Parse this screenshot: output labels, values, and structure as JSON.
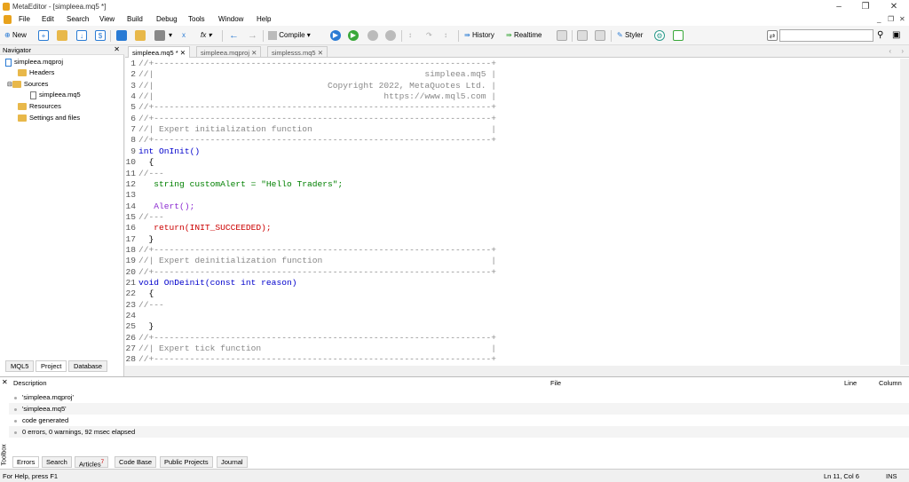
{
  "window": {
    "title": "MetaEditor - [simpleea.mq5 *]"
  },
  "menu": [
    "File",
    "Edit",
    "Search",
    "View",
    "Build",
    "Debug",
    "Tools",
    "Window",
    "Help"
  ],
  "toolbar": {
    "new": "New",
    "compile": "Compile",
    "history": "History",
    "realtime": "Realtime",
    "styler": "Styler"
  },
  "search": {
    "value": ""
  },
  "navigator": {
    "title": "Navigator",
    "project": "simpleea.mqproj",
    "headers": "Headers",
    "sources": "Sources",
    "source_file": "simpleea.mq5",
    "resources": "Resources",
    "settings": "Settings and files",
    "tabs": [
      "MQL5",
      "Project",
      "Database"
    ]
  },
  "file_tabs": [
    "simpleea.mq5 *",
    "simpleea.mqproj",
    "simplesss.mq5"
  ],
  "code_lines": [
    {
      "n": "1",
      "t": "//+------------------------------------------------------------------+"
    },
    {
      "n": "2",
      "t": "//|                                                     simpleea.mq5 |"
    },
    {
      "n": "3",
      "t": "//|                                  Copyright 2022, MetaQuotes Ltd. |"
    },
    {
      "n": "4",
      "t": "//|                                             https://www.mql5.com |"
    },
    {
      "n": "5",
      "t": "//+------------------------------------------------------------------+"
    },
    {
      "n": "6",
      "t": "//+------------------------------------------------------------------+"
    },
    {
      "n": "7",
      "t": "//| Expert initialization function                                   |"
    },
    {
      "n": "8",
      "t": "//+------------------------------------------------------------------+"
    },
    {
      "n": "9",
      "t": "int OnInit()"
    },
    {
      "n": "10",
      "t": "  {"
    },
    {
      "n": "11",
      "t": "//---"
    },
    {
      "n": "12",
      "t": "   string customAlert = \"Hello Traders\";"
    },
    {
      "n": "13",
      "t": ""
    },
    {
      "n": "14",
      "t": "   Alert();"
    },
    {
      "n": "15",
      "t": "//---"
    },
    {
      "n": "16",
      "t": "   return(INIT_SUCCEEDED);"
    },
    {
      "n": "17",
      "t": "  }"
    },
    {
      "n": "18",
      "t": "//+------------------------------------------------------------------+"
    },
    {
      "n": "19",
      "t": "//| Expert deinitialization function                                 |"
    },
    {
      "n": "20",
      "t": "//+------------------------------------------------------------------+"
    },
    {
      "n": "21",
      "t": "void OnDeinit(const int reason)"
    },
    {
      "n": "22",
      "t": "  {"
    },
    {
      "n": "23",
      "t": "//---"
    },
    {
      "n": "24",
      "t": ""
    },
    {
      "n": "25",
      "t": "  }"
    },
    {
      "n": "26",
      "t": "//+------------------------------------------------------------------+"
    },
    {
      "n": "27",
      "t": "//| Expert tick function                                             |"
    },
    {
      "n": "28",
      "t": "//+------------------------------------------------------------------+"
    }
  ],
  "toolbox": {
    "label": "Toolbox",
    "columns": {
      "description": "Description",
      "file": "File",
      "line": "Line",
      "column": "Column"
    },
    "messages": [
      "'simpleea.mqproj'",
      "'simpleea.mq5'",
      "code generated",
      "0 errors, 0 warnings, 92 msec elapsed"
    ],
    "tabs": [
      "Errors",
      "Search",
      "Articles",
      "Code Base",
      "Public Projects",
      "Journal"
    ],
    "articles_badge": "7"
  },
  "status": {
    "help": "For Help, press F1",
    "position": "Ln 11, Col 6",
    "mode": "INS"
  },
  "colors": {
    "keyword": "#0000cc",
    "function": "#8b2ad0",
    "string": "#008000",
    "constant": "#cc0000",
    "comment": "#888888"
  }
}
